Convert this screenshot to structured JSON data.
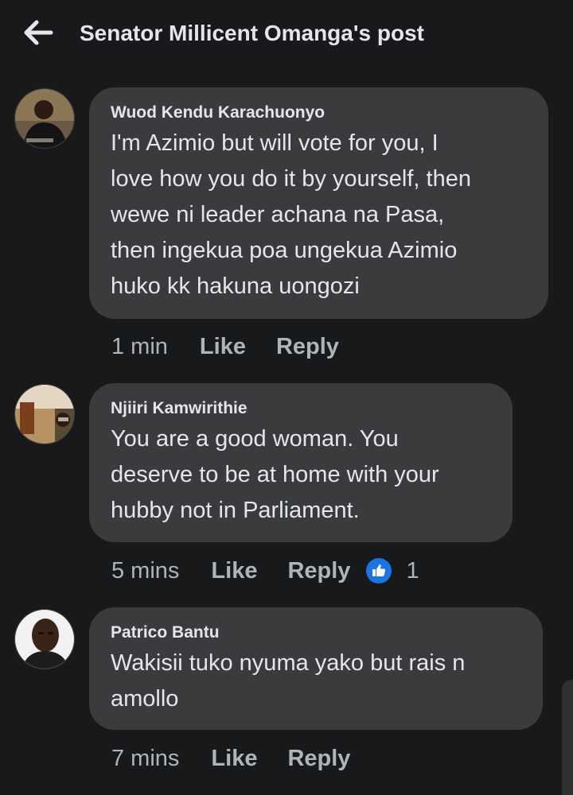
{
  "header": {
    "title": "Senator Millicent Omanga's post",
    "back_icon": "arrow-left-icon"
  },
  "comments": [
    {
      "author": "Wuod Kendu Karachuonyo",
      "text_lines": [
        "I'm Azimio but will vote for you, I",
        "love how you do it by yourself, then",
        "wewe ni leader achana na Pasa,",
        "then ingekua poa ungekua Azimio",
        "huko kk hakuna uongozi"
      ],
      "time": "1 min",
      "like_label": "Like",
      "reply_label": "Reply"
    },
    {
      "author": "Njiiri Kamwirithie",
      "text_lines": [
        "You are a good woman. You",
        "deserve to be at home with your",
        "hubby not in Parliament."
      ],
      "time": "5 mins",
      "like_label": "Like",
      "reply_label": "Reply",
      "reaction_icon": "thumbs-up-icon",
      "reaction_count": "1"
    },
    {
      "author": "Patrico Bantu",
      "text_lines": [
        "Wakisii tuko nyuma yako but rais n",
        "amollo"
      ],
      "time": "7 mins",
      "like_label": "Like",
      "reply_label": "Reply"
    }
  ],
  "colors": {
    "background": "#18191a",
    "bubble": "#3a3b3c",
    "primary_text": "#e4e6eb",
    "secondary_text": "#b0b3b8",
    "like_blue": "#1b74e4"
  }
}
